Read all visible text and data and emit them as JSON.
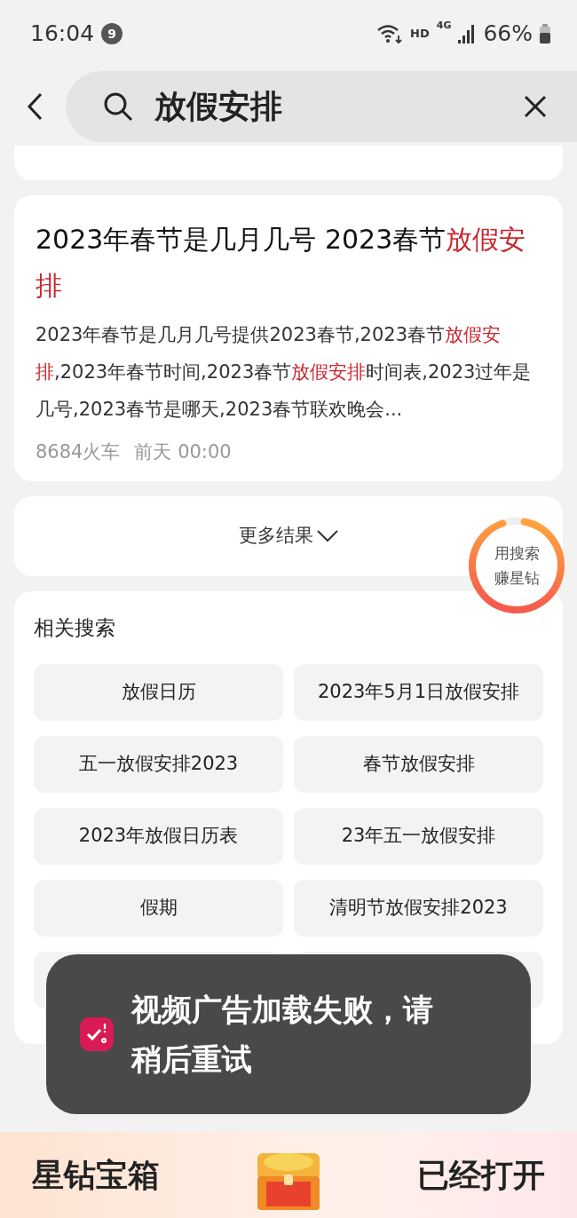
{
  "status_bar": {
    "time": "16:04",
    "notification_count": "9",
    "network": "HD",
    "cell": "4G",
    "battery": "66%"
  },
  "search": {
    "query": "放假安排"
  },
  "result": {
    "title": [
      {
        "text": "2023年春节是几月几号 2023春节",
        "highlight": false
      },
      {
        "text": "放假安排",
        "highlight": true
      }
    ],
    "snippet": [
      {
        "text": "2023年春节是几月几号提供2023春节,2023春节",
        "highlight": false
      },
      {
        "text": "放假安排",
        "highlight": true
      },
      {
        "text": ",2023年春节时间,2023春节",
        "highlight": false
      },
      {
        "text": "放假安排",
        "highlight": true
      },
      {
        "text": "时间表,2023过年是几号,2023春节是哪天,2023春节联欢晚会...",
        "highlight": false
      }
    ],
    "source": "8684火车",
    "time": "前天 00:00"
  },
  "more_results": "更多结果",
  "reward_badge": {
    "lines": [
      "用搜索",
      "赚星钻"
    ],
    "level": 0.92
  },
  "related": {
    "title": "相关搜索",
    "items": [
      "放假日历",
      "2023年5月1日放假安排",
      "五一放假安排2023",
      "春节放假安排",
      "2023年放假日历表",
      "23年五一放假安排",
      "假期",
      "清明节放假安排2023"
    ]
  },
  "toast": {
    "message": "视频广告加载失败，请稍后重试"
  },
  "banner": {
    "title": "星钻宝箱",
    "status": "已经打开"
  }
}
